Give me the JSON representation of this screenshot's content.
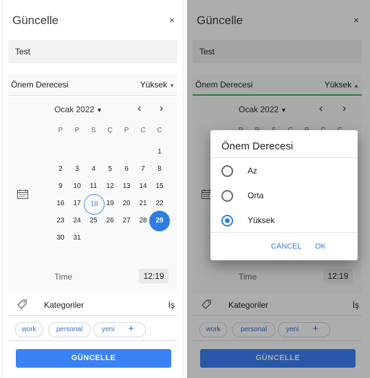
{
  "dialog_title": "Güncelle",
  "close_icon": "×",
  "task_name": "Test",
  "priority": {
    "label": "Önem Derecesi",
    "value": "Yüksek"
  },
  "calendar": {
    "month_label": "Ocak 2022",
    "prev_icon": "‹",
    "next_icon": "›",
    "weekdays": [
      "P",
      "P",
      "S",
      "Ç",
      "P",
      "C",
      "C"
    ],
    "weeks": [
      [
        "",
        "",
        "",
        "",
        "",
        "",
        "1"
      ],
      [
        "2",
        "3",
        "4",
        "5",
        "6",
        "7",
        "8"
      ],
      [
        "9",
        "10",
        "11",
        "12",
        "13",
        "14",
        "15"
      ],
      [
        "16",
        "17",
        "18",
        "19",
        "20",
        "21",
        "22"
      ],
      [
        "23",
        "24",
        "25",
        "26",
        "27",
        "28",
        "29"
      ],
      [
        "30",
        "31",
        "",
        "",
        "",
        "",
        ""
      ]
    ],
    "today": "18",
    "selected": "29"
  },
  "time": {
    "label": "Time",
    "value": "12:19"
  },
  "categories": {
    "label": "Kategoriler",
    "value": "İş"
  },
  "tags": [
    "work",
    "personal",
    "yeni"
  ],
  "add_tag_icon": "+",
  "update_button": "GÜNCELLE",
  "priority_dialog": {
    "title": "Önem Derecesi",
    "options": [
      "Az",
      "Orta",
      "Yüksek"
    ],
    "selected": "Yüksek",
    "cancel": "CANCEL",
    "ok": "OK"
  },
  "colors": {
    "accent": "#2f7de1",
    "button": "#3b82f6",
    "active_underline": "#4caf50"
  }
}
